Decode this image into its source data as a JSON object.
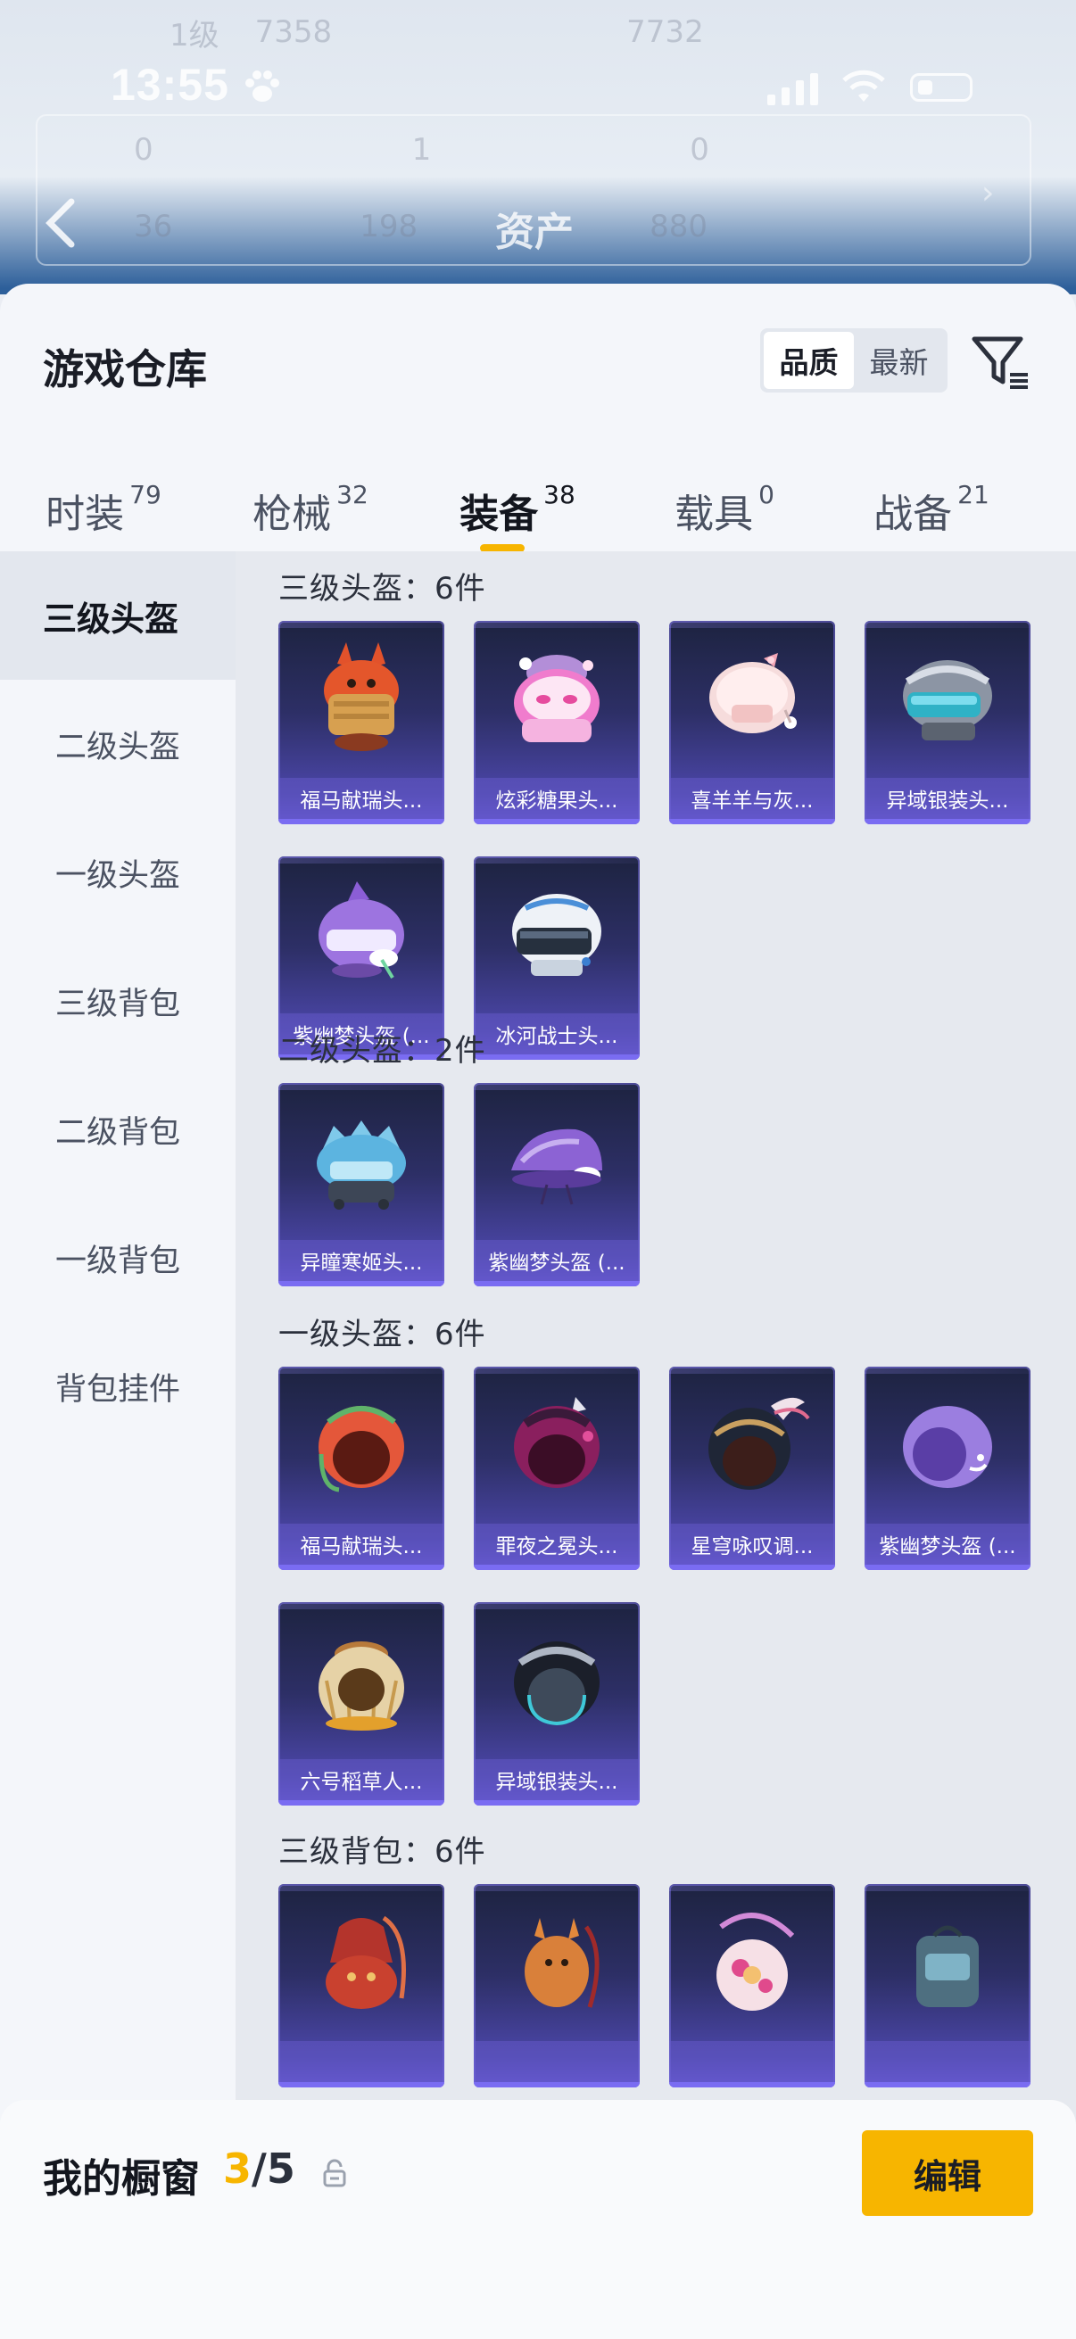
{
  "status_bar": {
    "time": "13:55"
  },
  "background_header": {
    "ghost_row1": [
      "1级",
      "7358",
      "7732"
    ],
    "ghost_row2": [
      "0",
      "1",
      "0"
    ],
    "ghost_row3": [
      "36",
      "198",
      "880"
    ],
    "title": "资产"
  },
  "sheet": {
    "title": "游戏仓库",
    "sort_options": [
      "品质",
      "最新"
    ],
    "sort_selected": "品质"
  },
  "tabs": [
    {
      "label": "时装",
      "count": "79"
    },
    {
      "label": "枪械",
      "count": "32"
    },
    {
      "label": "装备",
      "count": "38"
    },
    {
      "label": "载具",
      "count": "0"
    },
    {
      "label": "战备",
      "count": "21"
    }
  ],
  "active_tab": "装备",
  "categories": [
    "三级头盔",
    "二级头盔",
    "一级头盔",
    "三级背包",
    "二级背包",
    "一级背包",
    "背包挂件"
  ],
  "active_category": "三级头盔",
  "sections": [
    {
      "heading": "三级头盔：6件",
      "items": [
        "福马献瑞头...",
        "炫彩糖果头...",
        "喜羊羊与灰...",
        "异域银装头...",
        "紫幽梦头盔 (...",
        "冰河战士头..."
      ]
    },
    {
      "heading": "二级头盔：2件",
      "items": [
        "异瞳寒姬头...",
        "紫幽梦头盔 (..."
      ]
    },
    {
      "heading": "一级头盔：6件",
      "items": [
        "福马献瑞头...",
        "罪夜之冕头...",
        "星穹咏叹调...",
        "紫幽梦头盔 (...",
        "六号稻草人...",
        "异域银装头..."
      ]
    },
    {
      "heading": "三级背包：6件",
      "items": [
        "",
        "",
        "",
        ""
      ]
    }
  ],
  "bottom_bar": {
    "label": "我的橱窗",
    "current": "3",
    "separator": "/",
    "max": "5",
    "edit_label": "编辑"
  },
  "colors": {
    "accent": "#f7b500",
    "card_top": "#1d2340",
    "card_bottom": "#6657d6"
  }
}
